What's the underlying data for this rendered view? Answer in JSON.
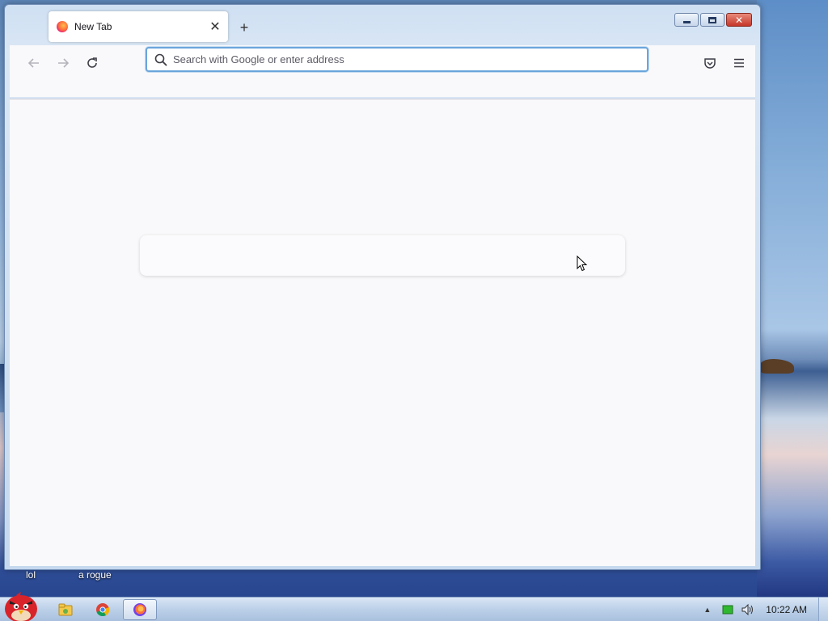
{
  "browser": {
    "tab": {
      "title": "New Tab",
      "close_glyph": "✕"
    },
    "new_tab_glyph": "+",
    "caption": {
      "minimize": "minimize-icon",
      "maximize": "maximize-icon",
      "close_glyph": "✕"
    },
    "nav": {
      "back": "back-arrow-icon",
      "forward": "forward-arrow-icon",
      "reload": "reload-icon"
    },
    "urlbar": {
      "placeholder": "Search with Google or enter address",
      "value": ""
    },
    "toolbar": {
      "pocket": "pocket-icon",
      "menu": "hamburger-menu-icon"
    }
  },
  "desktop": {
    "icons": [
      {
        "label": "lol"
      },
      {
        "label": "a rogue"
      }
    ]
  },
  "taskbar": {
    "start": "angry-bird-start-icon",
    "pinned": [
      {
        "name": "file-explorer-icon"
      },
      {
        "name": "chrome-icon"
      },
      {
        "name": "firefox-icon",
        "active": true
      }
    ],
    "tray": {
      "clock": "10:22 AM"
    }
  },
  "colors": {
    "accent": "#6aa5dc",
    "content_bg": "#f9f9fb",
    "window_frame": "#c5d8ee"
  }
}
